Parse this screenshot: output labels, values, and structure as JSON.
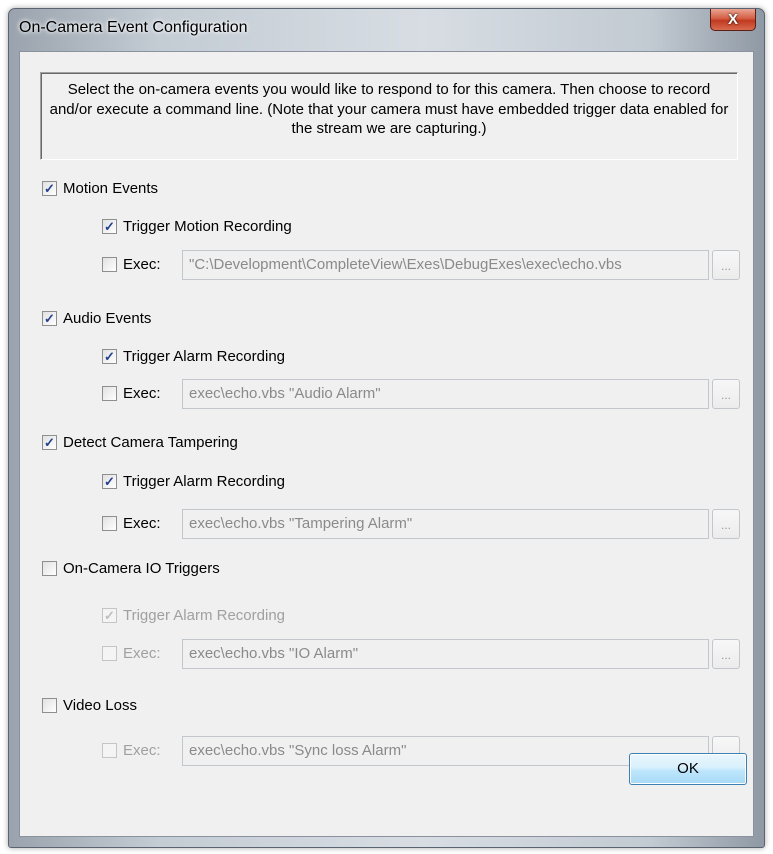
{
  "window": {
    "title": "On-Camera Event Configuration",
    "close_glyph": "X"
  },
  "instructions": "Select the on-camera events you would like to respond to for this camera. Then choose to record and/or execute a command line.  (Note that your camera must have embedded trigger data enabled for the stream we are capturing.)",
  "groups": [
    {
      "label": "Motion Events",
      "checked": true,
      "trigger": {
        "label": "Trigger Motion Recording",
        "checked": true,
        "enabled": true
      },
      "exec": {
        "label": "Exec:",
        "checked": false,
        "enabled": true,
        "value": "\"C:\\Development\\CompleteView\\Exes\\DebugExes\\exec\\echo.vbs",
        "browse": "..."
      }
    },
    {
      "label": "Audio Events",
      "checked": true,
      "trigger": {
        "label": "Trigger Alarm Recording",
        "checked": true,
        "enabled": true
      },
      "exec": {
        "label": "Exec:",
        "checked": false,
        "enabled": true,
        "value": "exec\\echo.vbs \"Audio Alarm\"",
        "browse": "..."
      }
    },
    {
      "label": "Detect Camera Tampering",
      "checked": true,
      "trigger": {
        "label": "Trigger Alarm Recording",
        "checked": true,
        "enabled": true
      },
      "exec": {
        "label": "Exec:",
        "checked": false,
        "enabled": true,
        "value": "exec\\echo.vbs \"Tampering Alarm\"",
        "browse": "..."
      }
    },
    {
      "label": "On-Camera IO Triggers",
      "checked": false,
      "trigger": {
        "label": "Trigger Alarm Recording",
        "checked": true,
        "enabled": false
      },
      "exec": {
        "label": "Exec:",
        "checked": false,
        "enabled": false,
        "value": "exec\\echo.vbs \"IO Alarm\"",
        "browse": "..."
      }
    },
    {
      "label": "Video Loss",
      "checked": false,
      "exec": {
        "label": "Exec:",
        "checked": false,
        "enabled": false,
        "value": "exec\\echo.vbs \"Sync loss Alarm\"",
        "browse": "..."
      }
    }
  ],
  "ok_label": "OK",
  "icons": {
    "checkmark": "checkmark-icon"
  },
  "colors": {
    "close": "#c0391f",
    "ok_border": "#3c7fb1",
    "check": "#23418c",
    "disabled_text": "#a0a0a0"
  }
}
